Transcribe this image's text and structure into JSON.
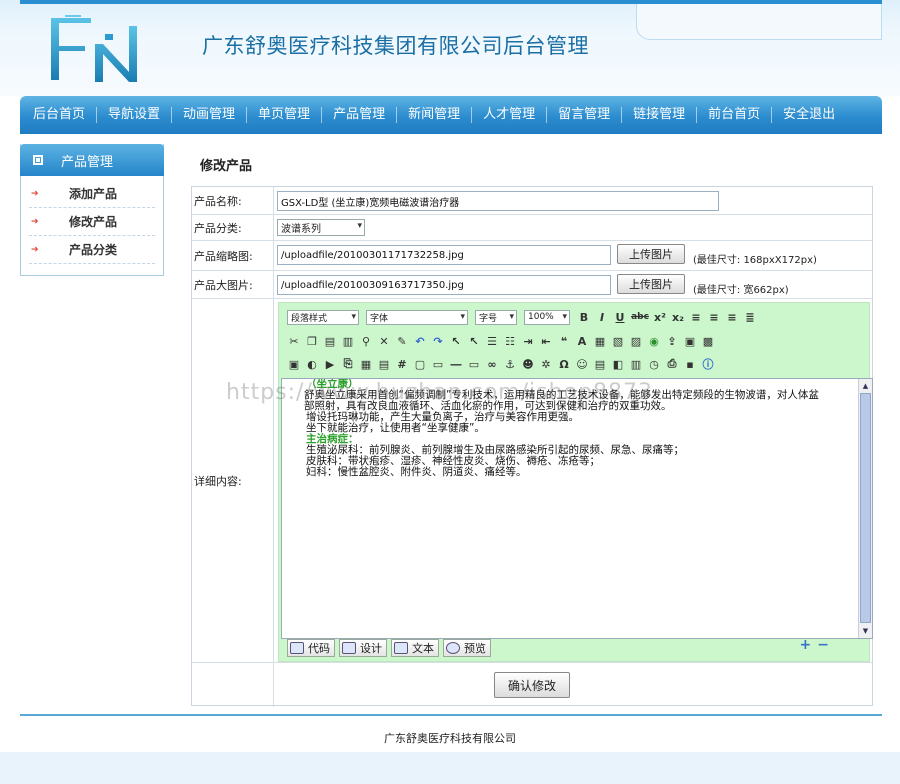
{
  "site": {
    "title": "广东舒奥医疗科技集团有限公司后台管理",
    "logo_text": "FN"
  },
  "nav": [
    "后台首页",
    "导航设置",
    "动画管理",
    "单页管理",
    "产品管理",
    "新闻管理",
    "人才管理",
    "留言管理",
    "链接管理",
    "前台首页",
    "安全退出"
  ],
  "sidebar": {
    "title": "产品管理",
    "items": [
      "添加产品",
      "修改产品",
      "产品分类"
    ]
  },
  "page": {
    "title": "修改产品"
  },
  "form": {
    "name_label": "产品名称:",
    "name_value": "GSX-LD型 (坐立康)宽频电磁波谱治疗器",
    "category_label": "产品分类:",
    "category_value": "波谱系列",
    "thumb_label": "产品缩略图:",
    "thumb_value": "/uploadfile/20100301171732258.jpg",
    "thumb_hint": "(最佳尺寸: 168pxX172px)",
    "big_label": "产品大图片:",
    "big_value": "/uploadfile/20100309163717350.jpg",
    "big_hint": "(最佳尺寸: 宽662px)",
    "upload_label": "上传图片",
    "detail_label": "详细内容:",
    "submit_label": "确认修改"
  },
  "editor": {
    "para_style": "段落样式",
    "font": "字体",
    "size": "字号",
    "zoom": "100%",
    "modes": [
      "代码",
      "设计",
      "文本",
      "预览"
    ],
    "content": [
      {
        "cls": "hd",
        "text": "（坐立康）"
      },
      {
        "cls": "l0",
        "text": "舒奥坐立康采用首创“偏频调制”专利技术，运用精良的工艺技术设备，能够发出特定频段的生物波谱，对人体盆"
      },
      {
        "cls": "l0",
        "text": "部照射，具有改良血液循环、活血化瘀的作用，可达到保健和治疗的双重功效。"
      },
      {
        "cls": "",
        "text": "增设托玛琳功能，产生大量负离子，治疗与美容作用更强。"
      },
      {
        "cls": "",
        "text": "坐下就能治疗，让使用者“坐享健康”。"
      },
      {
        "cls": "hd",
        "text": "  主治病症："
      },
      {
        "cls": "",
        "text": "生殖泌尿科：前列腺炎、前列腺增生及由尿路感染所引起的尿频、尿急、尿痛等；"
      },
      {
        "cls": "",
        "text": "皮肤科：带状疱疹、湿疹、神经性皮炎、烧伤、褥疮、冻疮等；"
      },
      {
        "cls": "",
        "text": "妇科：慢性盆腔炎、附件炎、阴道炎、痛经等。"
      }
    ]
  },
  "watermark": "https://www.huzhan.com/ishop8873",
  "footer": {
    "text": "广东舒奥医疗科技有限公司"
  }
}
